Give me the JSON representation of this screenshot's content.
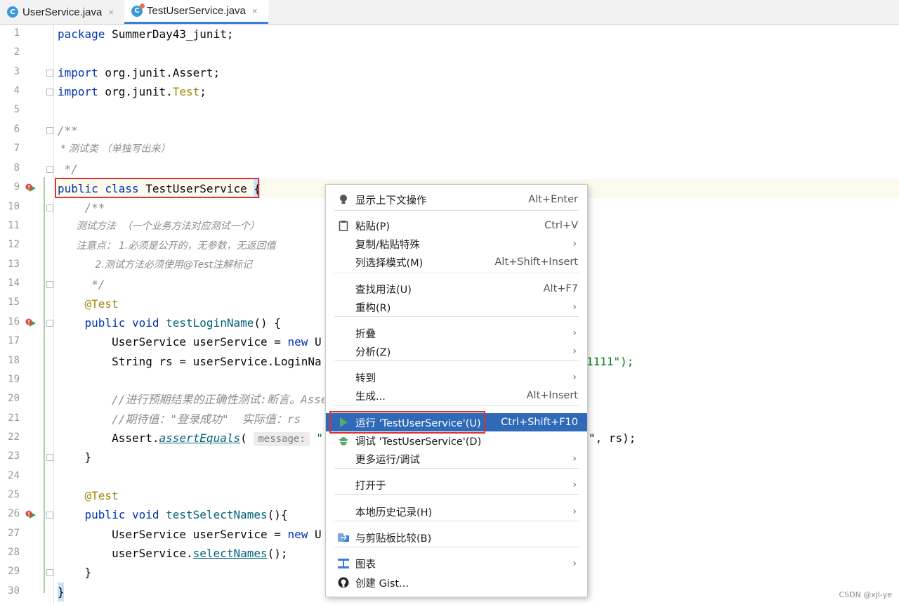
{
  "tabs": [
    {
      "label": "UserService.java",
      "icon": "class-icon",
      "active": false
    },
    {
      "label": "TestUserService.java",
      "icon": "test-class-icon",
      "active": true
    }
  ],
  "tab_close_glyph": "×",
  "line_numbers": [
    "1",
    "2",
    "3",
    "4",
    "5",
    "6",
    "7",
    "8",
    "9",
    "10",
    "11",
    "12",
    "13",
    "14",
    "15",
    "16",
    "17",
    "18",
    "19",
    "20",
    "21",
    "22",
    "23",
    "24",
    "25",
    "26",
    "27",
    "28",
    "29",
    "30"
  ],
  "code": {
    "l1_kw": "package",
    "l1_rest": " SummerDay43_junit;",
    "l3_kw": "import",
    "l3_rest": " org.junit.Assert;",
    "l4_kw": "import",
    "l4_mid": " org.junit.",
    "l4_an": "Test",
    "l4_end": ";",
    "l6": "/**",
    "l7": " * 测试类 （单独写出来）",
    "l8": " */",
    "l9_kw": "public class",
    "l9_name": " TestUserService ",
    "l9_brace": "{",
    "l10": "    /**",
    "l11": "      测试方法  （一个业务方法对应测试一个）",
    "l12": "      注意点： 1.必须是公开的，无参数，无返回值",
    "l13": "            2.测试方法必须使用@Test注解标记",
    "l14": "     */",
    "l15": "    @Test",
    "l16_kw": "    public void",
    "l16_fn": " testLoginName",
    "l16_end": "() {",
    "l17_a": "        UserService userService = ",
    "l17_kw": "new",
    "l17_b": " U",
    "l18_a": "        String rs = userService.LoginNa",
    "l18_b": "1111\");",
    "l20": "        //进行预期结果的正确性测试:断言。Asse",
    "l21": "        //期待值：\"登录成功\"  实际值：rs",
    "l22_a": "        Assert.",
    "l22_fn": "assertEquals",
    "l22_b": "( ",
    "l22_hint": "message:",
    "l22_c": " \"",
    "l22_d": "\", rs);",
    "l23": "    }",
    "l25": "    @Test",
    "l26_kw": "    public void",
    "l26_fn": " testSelectNames",
    "l26_end": "(){",
    "l27_a": "        UserService userService = ",
    "l27_kw": "new",
    "l27_b": " U",
    "l28_a": "        userService.",
    "l28_fn": "selectNames",
    "l28_b": "();",
    "l29": "    }",
    "l30": "}"
  },
  "context_menu": {
    "items": [
      {
        "label": "显示上下文操作",
        "shortcut": "Alt+Enter",
        "icon": "lightbulb-icon"
      },
      {
        "label": "粘贴(P)",
        "shortcut": "Ctrl+V",
        "icon": "clipboard-icon"
      },
      {
        "label": "复制/粘贴特殊",
        "submenu": true
      },
      {
        "label": "列选择模式(M)",
        "shortcut": "Alt+Shift+Insert"
      },
      {
        "label": "查找用法(U)",
        "shortcut": "Alt+F7"
      },
      {
        "label": "重构(R)",
        "submenu": true
      },
      {
        "label": "折叠",
        "submenu": true
      },
      {
        "label": "分析(Z)",
        "submenu": true
      },
      {
        "label": "转到",
        "submenu": true
      },
      {
        "label": "生成...",
        "shortcut": "Alt+Insert"
      },
      {
        "label": "运行 'TestUserService'(U)",
        "shortcut": "Ctrl+Shift+F10",
        "icon": "run-icon",
        "selected": true
      },
      {
        "label": "调试 'TestUserService'(D)",
        "icon": "debug-icon"
      },
      {
        "label": "更多运行/调试",
        "submenu": true
      },
      {
        "label": "打开于",
        "submenu": true
      },
      {
        "label": "本地历史记录(H)",
        "submenu": true
      },
      {
        "label": "与剪贴板比较(B)",
        "icon": "compare-icon"
      },
      {
        "label": "图表",
        "submenu": true,
        "icon": "diagram-icon"
      },
      {
        "label": "创建 Gist...",
        "icon": "github-icon"
      }
    ],
    "submenu_glyph": "›"
  },
  "colors": {
    "keyword": "#0033b3",
    "annotation": "#9e880d",
    "comment": "#8c8c8c",
    "string": "#067d17",
    "selection": "#2f6ab8",
    "highlight_box": "#e03030"
  },
  "watermark": "CSDN @xjl-ye"
}
